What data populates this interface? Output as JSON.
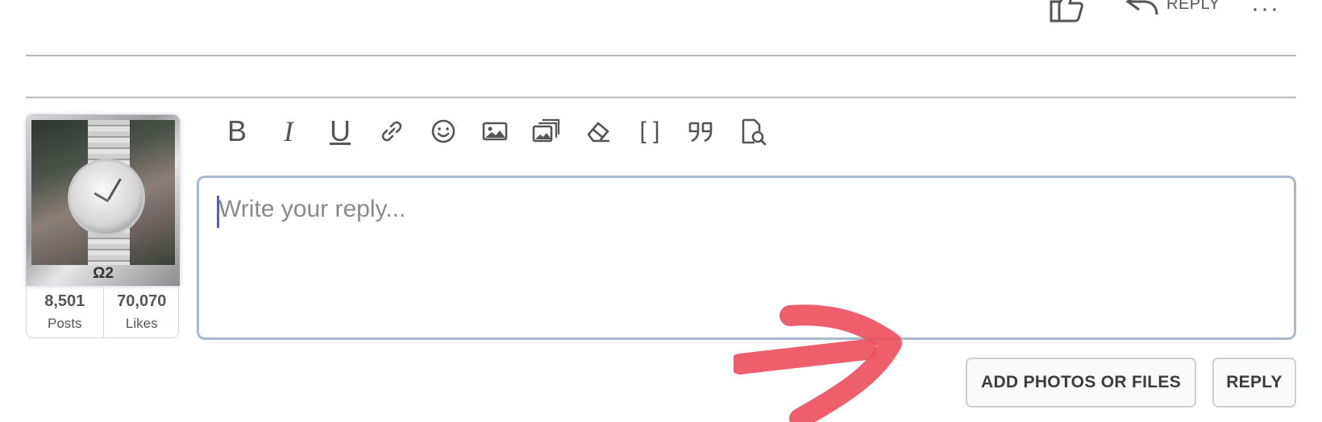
{
  "post_actions": {
    "like_icon": "thumbs-up-icon",
    "reply_label": "REPLY",
    "more_label": "···"
  },
  "user": {
    "rank": "Ω2",
    "posts_count": "8,501",
    "posts_label": "Posts",
    "likes_count": "70,070",
    "likes_label": "Likes"
  },
  "toolbar": {
    "buttons": [
      {
        "name": "bold",
        "glyph": "B"
      },
      {
        "name": "italic",
        "glyph": "I"
      },
      {
        "name": "underline",
        "glyph": "U"
      },
      {
        "name": "link",
        "icon": "link-icon"
      },
      {
        "name": "emoji",
        "icon": "smiley-icon"
      },
      {
        "name": "image",
        "icon": "image-icon"
      },
      {
        "name": "gallery",
        "icon": "gallery-icon"
      },
      {
        "name": "clear-formatting",
        "icon": "eraser-icon"
      },
      {
        "name": "bbcode",
        "glyph": "[ ]"
      },
      {
        "name": "quote",
        "icon": "quote-icon"
      },
      {
        "name": "preview",
        "icon": "preview-icon"
      }
    ]
  },
  "editor": {
    "placeholder": "Write your reply..."
  },
  "actions": {
    "add_files_label": "ADD PHOTOS OR FILES",
    "reply_label": "REPLY"
  },
  "colors": {
    "editor_border": "#a9b8cf",
    "caret": "#4a5fd1",
    "annotation_arrow": "#ee5060"
  }
}
